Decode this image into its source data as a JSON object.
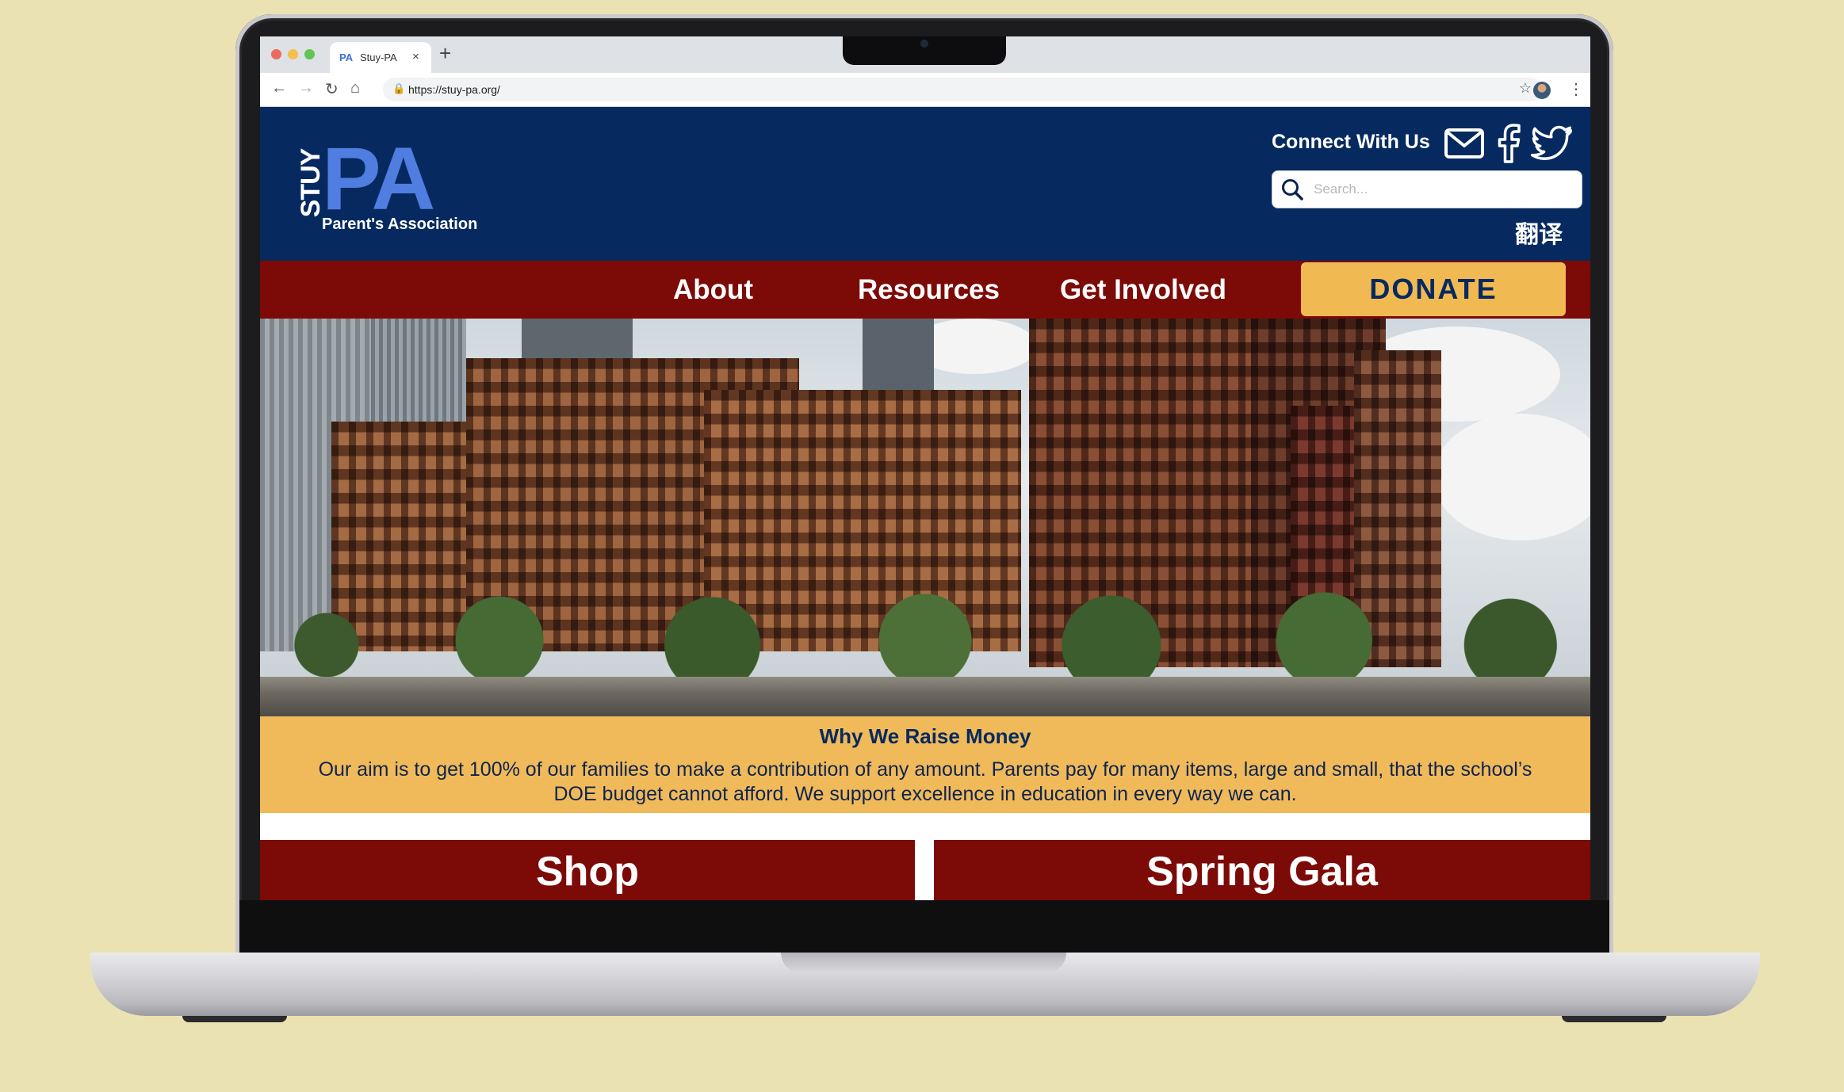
{
  "browser": {
    "tab_title": "Stuy-PA",
    "tab_favicon": "PA",
    "url": "https://stuy-pa.org/",
    "close_glyph": "×",
    "new_tab_glyph": "+"
  },
  "site": {
    "logo": {
      "stuy": "STUY",
      "pa": "PA",
      "subtitle": "Parent's Association"
    },
    "connect_label": "Connect With Us",
    "social_icons": [
      "mail-icon",
      "facebook-icon",
      "twitter-icon"
    ],
    "search": {
      "placeholder": "Search..."
    },
    "translate_label": "翻译",
    "nav": {
      "items": [
        "About",
        "Resources",
        "Get Involved"
      ],
      "donate": "DONATE"
    },
    "why": {
      "heading": "Why We Raise Money",
      "body": "Our aim is to get 100% of our families to make a contribution of any amount. Parents pay for many items, large and small, that the school’s DOE budget cannot afford. We support excellence in education in every way we can."
    },
    "cards": [
      "Shop",
      "Spring Gala"
    ]
  },
  "colors": {
    "header_navy": "#062a60",
    "nav_red": "#7c0a06",
    "donate_gold": "#f1b952",
    "why_gold": "#f0ba5a",
    "logo_blue": "#4f7de0",
    "page_bg": "#ebe2b3"
  }
}
